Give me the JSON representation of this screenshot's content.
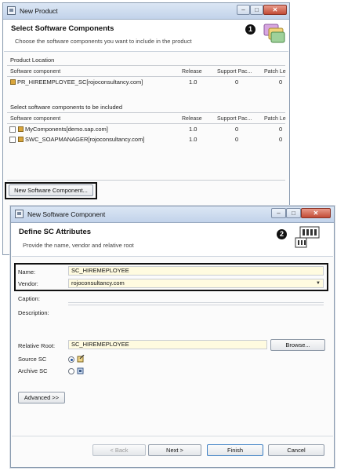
{
  "product_window": {
    "title": "New Product",
    "header_title": "Select Software Components",
    "header_subtitle": "Choose the software components you want to include in the product",
    "badge": "1",
    "product_location": {
      "label": "Product Location",
      "columns": [
        "Software component",
        "Release",
        "Support Pac...",
        "Patch Le"
      ],
      "rows": [
        {
          "name": "PR_HIREEMPLOYEE_SC[rojoconsultancy.com]",
          "release": "1.0",
          "support": "0",
          "patch": "0"
        }
      ]
    },
    "included": {
      "label": "Select software components to be included",
      "columns": [
        "Software component",
        "Release",
        "Support Pac...",
        "Patch Le"
      ],
      "rows": [
        {
          "name": "MyComponents[demo.sap.com]",
          "release": "1.0",
          "support": "0",
          "patch": "0",
          "checked": false
        },
        {
          "name": "SWC_SOAPMANAGER[rojoconsultancy.com]",
          "release": "1.0",
          "support": "0",
          "patch": "0",
          "checked": false
        }
      ]
    },
    "new_sc_button": "New Software Component..."
  },
  "sc_window": {
    "title": "New Software Component",
    "header_title": "Define SC Attributes",
    "header_subtitle": "Provide the name, vendor and relative root",
    "badge": "2",
    "fields": {
      "name_label": "Name:",
      "name_value": "SC_HIREMEPLOYEE",
      "vendor_label": "Vendor:",
      "vendor_value": "rojoconsultancy.com",
      "caption_label": "Caption:",
      "description_label": "Description:",
      "relative_root_label": "Relative Root:",
      "relative_root_value": "SC_HIREMEPLOYEE",
      "browse_button": "Browse...",
      "source_sc_label": "Source SC",
      "archive_sc_label": "Archive SC",
      "selected_type": "Source SC"
    },
    "advanced_button": "Advanced >>",
    "footer": {
      "back": "< Back",
      "next": "Next >",
      "finish": "Finish",
      "cancel": "Cancel"
    }
  },
  "colors": {
    "field_bg": "#fffbe0",
    "highlight_border": "#111111",
    "titlebar": "#c2d3ea"
  }
}
